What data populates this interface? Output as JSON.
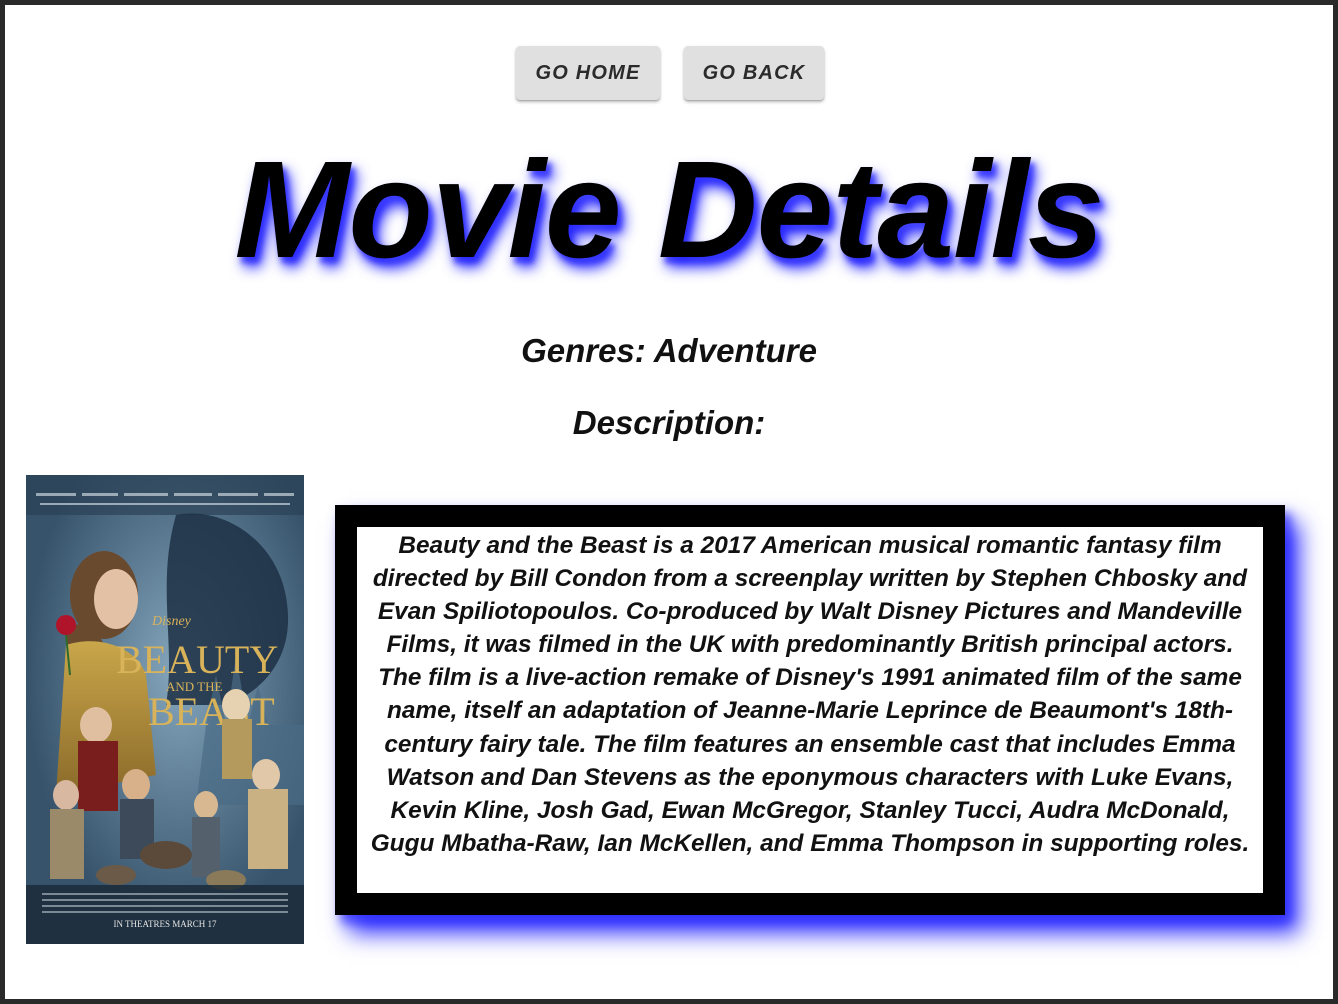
{
  "nav": {
    "home_label": "GO HOME",
    "back_label": "GO BACK"
  },
  "page": {
    "title": "Movie Details",
    "genres": "Genres: Adventure",
    "description_label": "Description:"
  },
  "movie": {
    "description": "Beauty and the Beast is a 2017 American musical romantic fantasy film directed by Bill Condon from a screenplay written by Stephen Chbosky and Evan Spiliotopoulos. Co-produced by Walt Disney Pictures and Mandeville Films, it was filmed in the UK with predominantly British principal actors. The film is a live-action remake of Disney's 1991 animated film of the same name, itself an adaptation of Jeanne-Marie Leprince de Beaumont's 18th-century fairy tale. The film features an ensemble cast that includes Emma Watson and Dan Stevens as the eponymous characters with Luke Evans, Kevin Kline, Josh Gad, Ewan McGregor, Stanley Tucci, Audra McDonald, Gugu Mbatha-Raw, Ian McKellen, and Emma Thompson in supporting roles.",
    "poster": {
      "brand": "Disney",
      "title_line1": "BEAUTY",
      "title_line2": "AND THE",
      "title_line3": "BEAST",
      "release": "IN THEATRES MARCH 17"
    }
  },
  "colors": {
    "shadow_accent": "#2626ff",
    "button_bg": "#e0e0e0",
    "frame_border": "#2a2a2a"
  }
}
